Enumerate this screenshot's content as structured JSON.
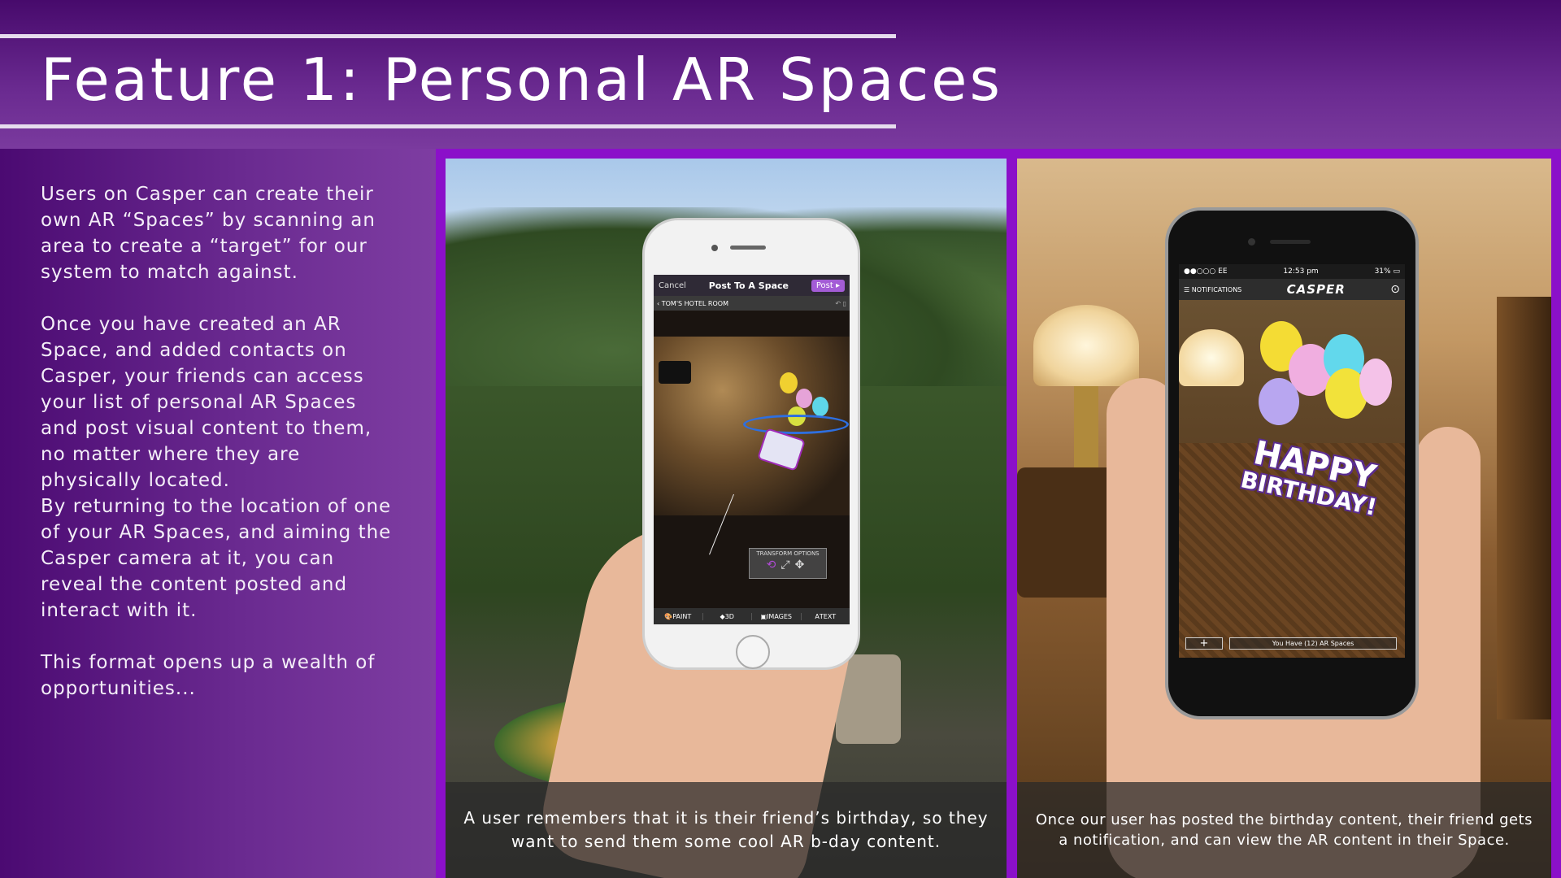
{
  "header": {
    "title": "Feature 1: Personal AR Spaces"
  },
  "sidebar": {
    "paragraphs": [
      "Users on Casper can create their own AR “Spaces” by scanning an area to create a “target” for our system to match against.",
      "Once you have created an AR Space, and added contacts on Casper, your friends can access your list of personal AR Spaces and post visual content to them, no matter where they are physically located.",
      "By returning to the location of one of your AR Spaces, and aiming the Casper camera at it, you can reveal the content posted and interact with it.",
      "This format opens up a wealth of opportunities..."
    ]
  },
  "panel_left": {
    "caption": "A user remembers that it is their friend’s birthday, so they want to send them some cool AR b-day content.",
    "app": {
      "cancel": "Cancel",
      "title": "Post To A Space",
      "post": "Post",
      "location": "TOM'S HOTEL ROOM",
      "transform_label": "TRANSFORM OPTIONS",
      "tools": [
        "PAINT",
        "3D",
        "IMAGES",
        "TEXT"
      ]
    }
  },
  "panel_right": {
    "caption": "Once our user has posted the birthday content, their friend gets a notification, and can view the AR content in their Space.",
    "app": {
      "carrier": "EE",
      "time": "12:53 pm",
      "battery": "31%",
      "notifications": "NOTIFICATIONS",
      "brand": "CASPER",
      "overlay_line1": "HAPPY",
      "overlay_line2": "BIRTHDAY!",
      "add": "+",
      "spaces": "You Have (12) AR Spaces"
    }
  },
  "colors": {
    "accent": "#8b10c9",
    "app_purple": "#a35cd6",
    "header_rule": "#e6dcee"
  }
}
